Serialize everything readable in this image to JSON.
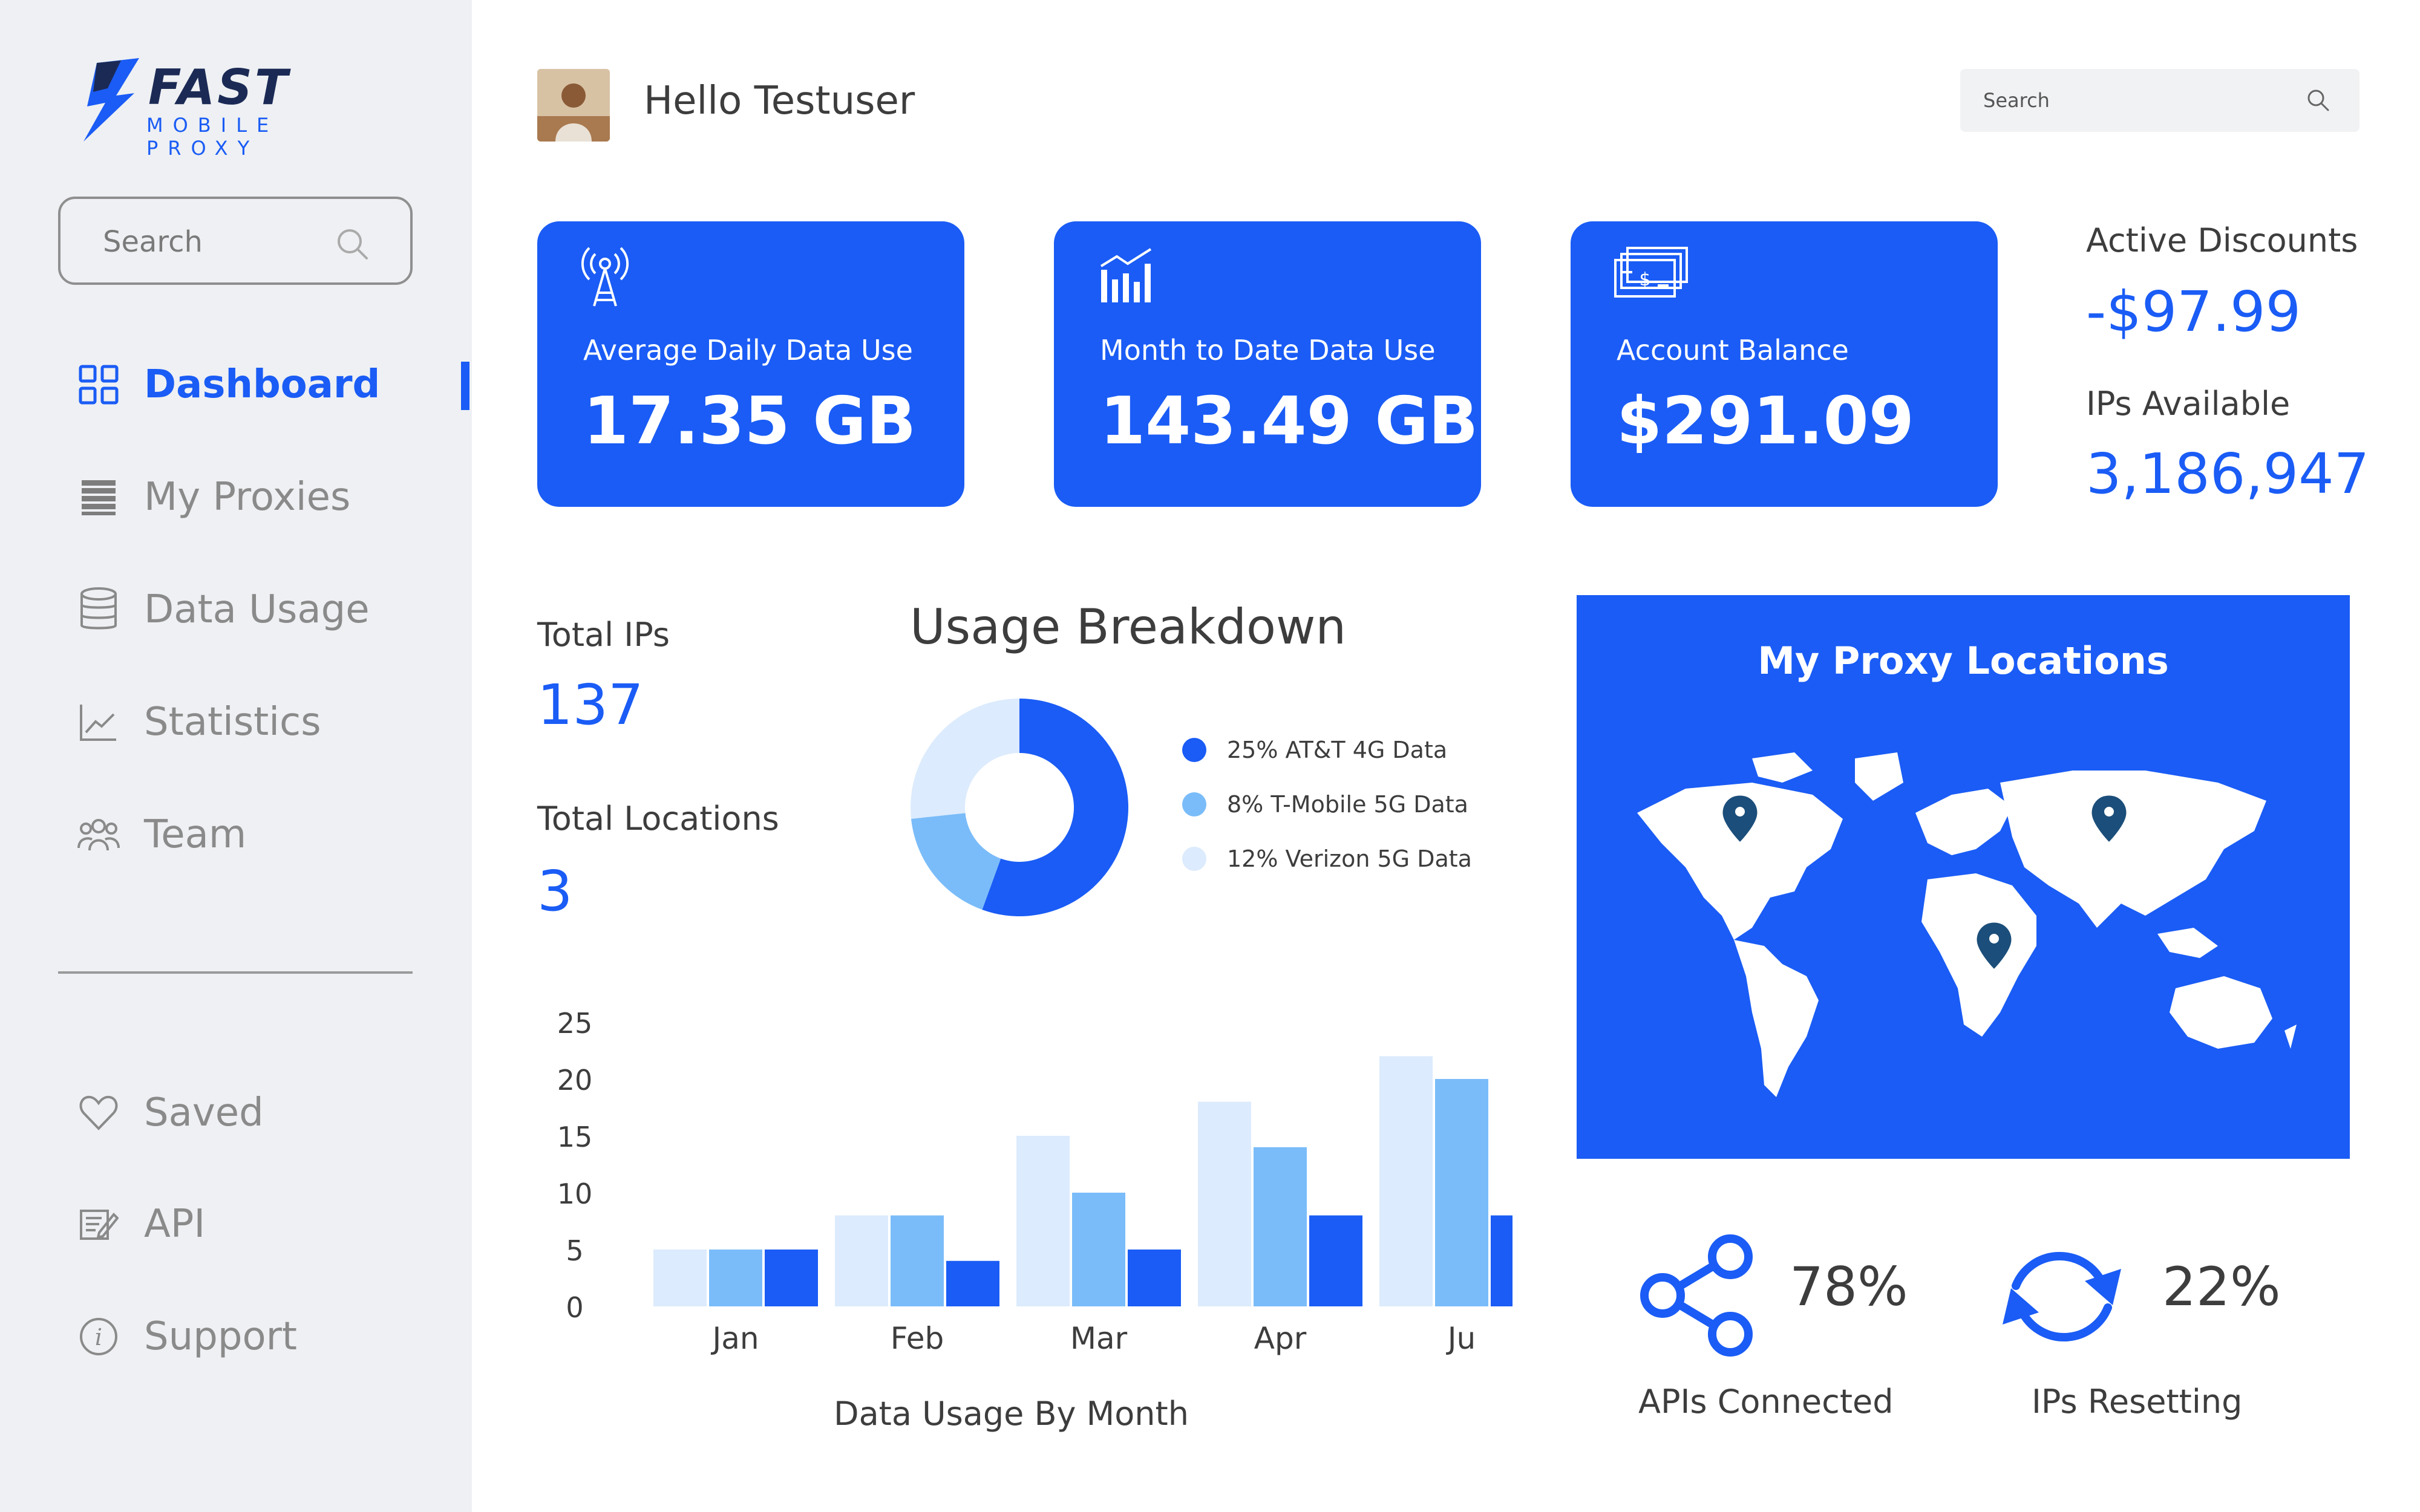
{
  "brand": {
    "name": "FAST",
    "tagline": "MOBILE PROXY",
    "colors": {
      "primary": "#1a5cf5",
      "dark": "#1b2a55"
    }
  },
  "sidebar": {
    "search_placeholder": "Search",
    "items": [
      {
        "label": "Dashboard",
        "icon": "grid-icon",
        "active": true
      },
      {
        "label": "My Proxies",
        "icon": "list-icon"
      },
      {
        "label": "Data Usage",
        "icon": "database-icon"
      },
      {
        "label": "Statistics",
        "icon": "chart-line-icon"
      },
      {
        "label": "Team",
        "icon": "team-icon"
      }
    ],
    "bottom_items": [
      {
        "label": "Saved",
        "icon": "heart-icon"
      },
      {
        "label": "API",
        "icon": "edit-icon"
      },
      {
        "label": "Support",
        "icon": "info-icon"
      }
    ]
  },
  "header": {
    "greeting": "Hello Testuser",
    "search_placeholder": "Search"
  },
  "cards": [
    {
      "label": "Average Daily Data Use",
      "value": "17.35 GB",
      "icon": "antenna-icon"
    },
    {
      "label": "Month to Date Data Use",
      "value": "143.49 GB",
      "icon": "bar-chart-icon"
    },
    {
      "label": "Account Balance",
      "value": "$291.09",
      "icon": "money-icon"
    }
  ],
  "discounts": {
    "active_label": "Active Discounts",
    "active_value": "-$97.99",
    "ips_label": "IPs Available",
    "ips_value": "3,186,947"
  },
  "totals": {
    "ips_label": "Total IPs",
    "ips_value": "137",
    "locations_label": "Total Locations",
    "locations_value": "3"
  },
  "usage_breakdown": {
    "title": "Usage Breakdown",
    "legend": [
      {
        "label": "25% AT&T 4G Data",
        "color": "#1a5cf5"
      },
      {
        "label": "8% T-Mobile 5G Data",
        "color": "#7abcf9"
      },
      {
        "label": "12% Verizon 5G Data",
        "color": "#dcebfd"
      }
    ]
  },
  "map": {
    "title": "My Proxy Locations"
  },
  "metrics": [
    {
      "value": "78%",
      "label": "APIs Connected",
      "icon": "share-icon"
    },
    {
      "value": "22%",
      "label": "IPs Resetting",
      "icon": "refresh-icon"
    }
  ],
  "chart_data": [
    {
      "type": "pie",
      "title": "Usage Breakdown",
      "categories": [
        "AT&T 4G Data",
        "T-Mobile 5G Data",
        "Verizon 5G Data"
      ],
      "values": [
        25,
        8,
        12
      ],
      "colors": [
        "#1a5cf5",
        "#7abcf9",
        "#dcebfd"
      ],
      "legend": "right"
    },
    {
      "type": "bar",
      "title": "Data Usage By Month",
      "categories": [
        "Jan",
        "Feb",
        "Mar",
        "Apr",
        "Ju"
      ],
      "series": [
        {
          "values": [
            5,
            8,
            15,
            18,
            22
          ],
          "color": "#dcebfd"
        },
        {
          "values": [
            5,
            8,
            10,
            14,
            20
          ],
          "color": "#7abcf9"
        },
        {
          "values": [
            5,
            4,
            5,
            8,
            8
          ],
          "color": "#1a5cf5"
        }
      ],
      "ylim": [
        0,
        25
      ],
      "yticks": [
        0,
        5,
        10,
        15,
        20,
        25
      ],
      "grid": false,
      "xlabel": "",
      "ylabel": ""
    }
  ]
}
